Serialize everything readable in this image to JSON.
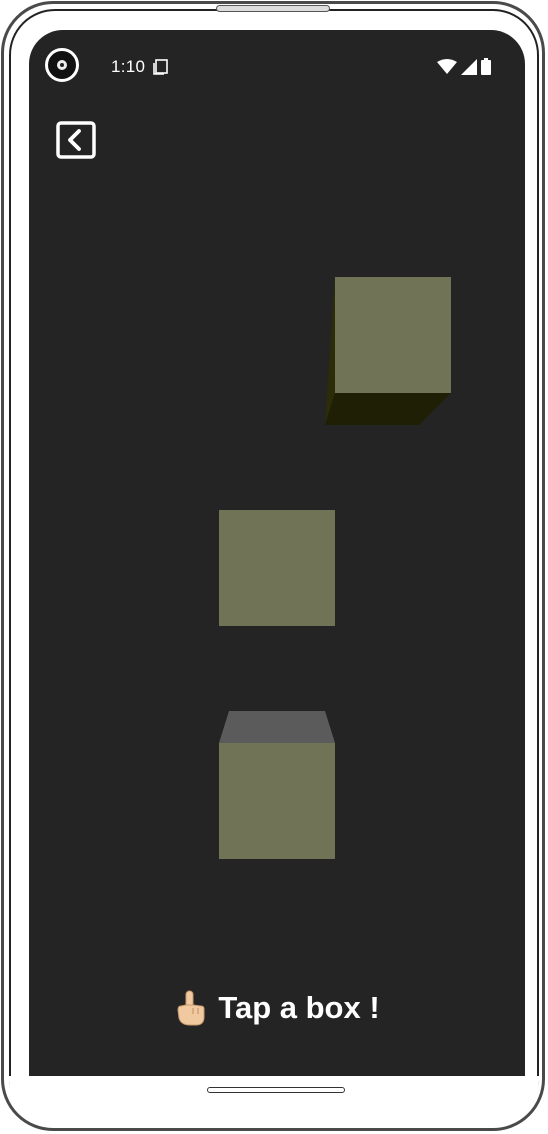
{
  "status_bar": {
    "time": "1:10",
    "icons": [
      "camera-icon",
      "sim-card-icon",
      "wifi-icon",
      "signal-icon",
      "battery-icon"
    ]
  },
  "header": {
    "back_icon": "chevron-left-icon"
  },
  "scene": {
    "box_count": 3,
    "colors": {
      "background": "#242424",
      "box_face": "#717356",
      "box_side_dark": "#2c2c08",
      "box_top_gray": "#5b5b5b"
    }
  },
  "prompt": {
    "icon": "pointing-hand-icon",
    "text": "Tap a box !"
  }
}
